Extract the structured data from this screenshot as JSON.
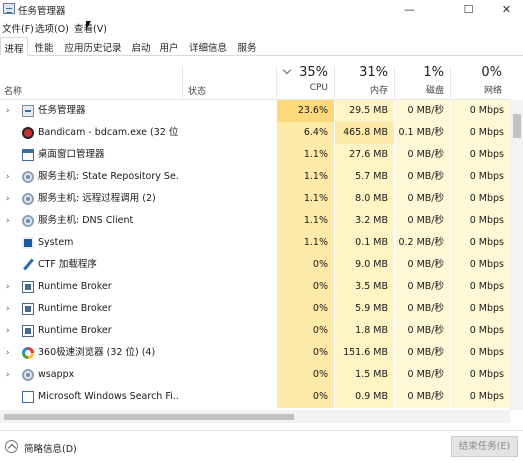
{
  "window": {
    "title": "任务管理器"
  },
  "menu": [
    "文件(F)",
    "选项(O)",
    "查看(V)"
  ],
  "tabs": [
    "进程",
    "性能",
    "应用历史记录",
    "启动",
    "用户",
    "详细信息",
    "服务"
  ],
  "header": {
    "name_label": "名称",
    "status_label": "状态",
    "cpu_pct": "35%",
    "cpu_label": "CPU",
    "mem_pct": "31%",
    "mem_label": "内存",
    "disk_pct": "1%",
    "disk_label": "磁盘",
    "net_pct": "0%",
    "net_label": "网络"
  },
  "colors": {
    "heat_high": "#fcd97a",
    "heat_mid": "#fde9a8",
    "heat_low": "#fff4c4",
    "heat_light": "#fff8d6"
  },
  "rows": [
    {
      "icon": "task-manager-icon",
      "expand": true,
      "name": "任务管理器",
      "cpu": "23.6%",
      "mem": "29.5 MB",
      "disk": "0 MB/秒",
      "net": "0 Mbps"
    },
    {
      "icon": "bandicam-icon",
      "expand": false,
      "name": "Bandicam - bdcam.exe (32 位)",
      "cpu": "6.4%",
      "mem": "465.8 MB",
      "disk": "0.1 MB/秒",
      "net": "0 Mbps"
    },
    {
      "icon": "window-icon",
      "expand": false,
      "name": "桌面窗口管理器",
      "cpu": "1.1%",
      "mem": "27.6 MB",
      "disk": "0 MB/秒",
      "net": "0 Mbps"
    },
    {
      "icon": "gear-icon",
      "expand": true,
      "name": "服务主机: State Repository Se...",
      "cpu": "1.1%",
      "mem": "5.7 MB",
      "disk": "0 MB/秒",
      "net": "0 Mbps"
    },
    {
      "icon": "gear-icon",
      "expand": true,
      "name": "服务主机: 远程过程调用 (2)",
      "cpu": "1.1%",
      "mem": "8.0 MB",
      "disk": "0 MB/秒",
      "net": "0 Mbps"
    },
    {
      "icon": "gear-icon",
      "expand": true,
      "name": "服务主机: DNS Client",
      "cpu": "1.1%",
      "mem": "3.2 MB",
      "disk": "0 MB/秒",
      "net": "0 Mbps"
    },
    {
      "icon": "system-icon",
      "expand": false,
      "name": "System",
      "cpu": "1.1%",
      "mem": "0.1 MB",
      "disk": "0.2 MB/秒",
      "net": "0 Mbps"
    },
    {
      "icon": "pen-icon",
      "expand": false,
      "name": "CTF 加载程序",
      "cpu": "0%",
      "mem": "9.0 MB",
      "disk": "0 MB/秒",
      "net": "0 Mbps"
    },
    {
      "icon": "runtime-broker-icon",
      "expand": true,
      "name": "Runtime Broker",
      "cpu": "0%",
      "mem": "3.5 MB",
      "disk": "0 MB/秒",
      "net": "0 Mbps"
    },
    {
      "icon": "runtime-broker-icon",
      "expand": true,
      "name": "Runtime Broker",
      "cpu": "0%",
      "mem": "5.9 MB",
      "disk": "0 MB/秒",
      "net": "0 Mbps"
    },
    {
      "icon": "runtime-broker-icon",
      "expand": true,
      "name": "Runtime Broker",
      "cpu": "0%",
      "mem": "1.8 MB",
      "disk": "0 MB/秒",
      "net": "0 Mbps"
    },
    {
      "icon": "browser-360-icon",
      "expand": true,
      "name": "360极速浏览器 (32 位) (4)",
      "cpu": "0%",
      "mem": "151.6 MB",
      "disk": "0 MB/秒",
      "net": "0 Mbps"
    },
    {
      "icon": "gear-icon",
      "expand": true,
      "name": "wsappx",
      "cpu": "0%",
      "mem": "1.5 MB",
      "disk": "0 MB/秒",
      "net": "0 Mbps"
    },
    {
      "icon": "search-icon",
      "expand": false,
      "name": "Microsoft Windows Search Fi...",
      "cpu": "0%",
      "mem": "0.9 MB",
      "disk": "0 MB/秒",
      "net": "0 Mbps"
    }
  ],
  "footer": {
    "fewer_details": "简略信息(D)",
    "end_task": "结束任务(E)"
  }
}
